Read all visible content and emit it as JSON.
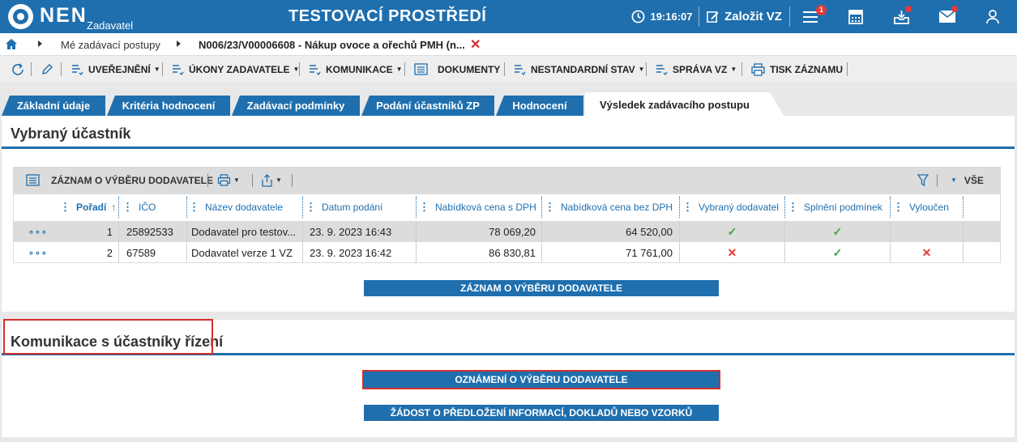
{
  "header": {
    "logo_text": "NEN",
    "logo_sub": "Zadavatel",
    "env_title": "TESTOVACÍ PROSTŘEDÍ",
    "time": "19:16:07",
    "create_label": "Založit VZ",
    "menu_badge": "1",
    "colors": {
      "primary": "#1f6fae",
      "alert": "#e53935"
    }
  },
  "breadcrumb": {
    "home_icon": "home-icon",
    "items": [
      "Mé zadávací postupy",
      "N006/23/V00006608 - Nákup ovoce a ořechů PMH (n..."
    ]
  },
  "toolbar": {
    "items": [
      {
        "label": "UVEŘEJNĚNÍ",
        "dropdown": true
      },
      {
        "label": "ÚKONY ZADAVATELE",
        "dropdown": true
      },
      {
        "label": "KOMUNIKACE",
        "dropdown": true
      },
      {
        "label": "DOKUMENTY",
        "dropdown": false
      },
      {
        "label": "NESTANDARDNÍ STAV",
        "dropdown": true
      },
      {
        "label": "SPRÁVA VZ",
        "dropdown": true
      },
      {
        "label": "TISK ZÁZNAMU",
        "dropdown": false
      }
    ]
  },
  "tabs": [
    {
      "label": "Základní údaje",
      "active": false
    },
    {
      "label": "Kritéria hodnocení",
      "active": false
    },
    {
      "label": "Zadávací podmínky",
      "active": false
    },
    {
      "label": "Podání účastníků ZP",
      "active": false
    },
    {
      "label": "Hodnocení",
      "active": false
    },
    {
      "label": "Výsledek zadávacího postupu",
      "active": true
    }
  ],
  "selected_section": {
    "title": "Vybraný účastník",
    "grid_title": "ZÁZNAM O VÝBĚRU DODAVATELE",
    "grid_all_label": "VŠE",
    "columns": [
      "Pořadí",
      "IČO",
      "Název dodavatele",
      "Datum podání",
      "Nabídková cena s DPH",
      "Nabídková cena bez DPH",
      "Vybraný dodavatel",
      "Splnění podmínek",
      "Vyloučen"
    ],
    "rows": [
      {
        "poradi": "1",
        "ico": "25892533",
        "nazev": "Dodavatel pro testov...",
        "datum": "23. 9. 2023 16:43",
        "cena_s_dph": "78 069,20",
        "cena_bez_dph": "64 520,00",
        "vybrany": true,
        "splneni": true,
        "vyloucen": false
      },
      {
        "poradi": "2",
        "ico": "67589",
        "nazev": "Dodavatel verze 1 VZ",
        "datum": "23. 9. 2023 16:42",
        "cena_s_dph": "86 830,81",
        "cena_bez_dph": "71 761,00",
        "vybrany": false,
        "splneni": true,
        "vyloucen": true
      }
    ],
    "record_button": "ZÁZNAM O VÝBĚRU DODAVATELE"
  },
  "communication_section": {
    "title": "Komunikace s účastníky řízení",
    "notify_button": "OZNÁMENÍ O VÝBĚRU DODAVATELE",
    "request_button": "ŽÁDOST O PŘEDLOŽENÍ INFORMACÍ, DOKLADŮ NEBO VZORKŮ"
  }
}
